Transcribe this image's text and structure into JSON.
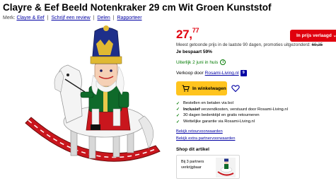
{
  "product": {
    "title": "Clayre & Eef Beeld Notenkraker 29 cm Wit Groen Kunststof",
    "brand_prefix": "Merk:",
    "brand": "Clayre & Eef",
    "write_review": "Schrijf een review",
    "share": "Delen",
    "report": "Rapporteer",
    "separator": "|",
    "image_icon": "nutcracker-rocking-horse-image"
  },
  "pricing": {
    "price_main": "27,",
    "price_cents": "77",
    "badge": "In prijs verlaagd",
    "badge_chevron": "⌄",
    "lowest_note": "Meest getoonde prijs in de laatste 90 dagen, promoties uitgezonderd:",
    "old_price": "69,25",
    "savings": "Je bespaart 59%",
    "accent_color": "#e0000e"
  },
  "delivery": {
    "text": "Uiterlijk 2 juni in huis",
    "info": "i",
    "color": "#007a00"
  },
  "seller": {
    "prefix": "Verkoop door",
    "name": "Rosami-Living.nl",
    "rating": "9"
  },
  "actions": {
    "cart_label": "In winkelwagen",
    "cart_icon": "cart-icon",
    "wishlist_icon": "heart-icon",
    "cart_color": "#ffc41e"
  },
  "usps": [
    {
      "bold": "",
      "text": "Bestellen en betalen via bol"
    },
    {
      "bold": "Inclusief",
      "text": " verzendkosten, verstuurd door Rosami-Living.nl"
    },
    {
      "bold": "",
      "text": "30 dagen bedenktijd en gratis retourneren"
    },
    {
      "bold": "",
      "text": "Wettelijke garantie via Rosami-Living.nl"
    }
  ],
  "links": {
    "returns": "Bekijk retourvoorwaarden",
    "partner": "Bekijk extra partnervoorwaarden"
  },
  "shop": {
    "heading": "Shop dit artikel",
    "card_line1": "Bij 3 partners",
    "card_line2": "verkrijgbaar"
  }
}
